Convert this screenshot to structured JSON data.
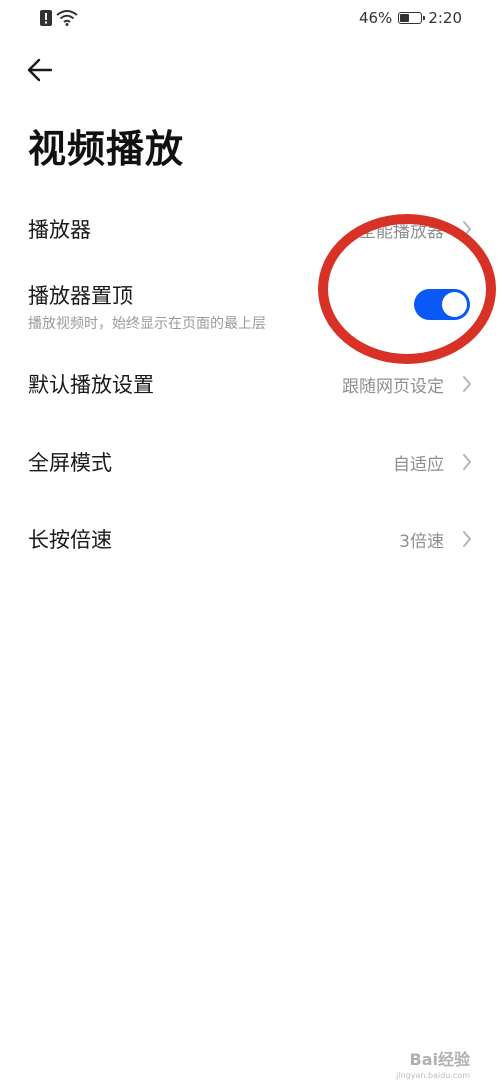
{
  "status_bar": {
    "battery_percent": "46%",
    "battery_level": 0.46,
    "time": "2:20"
  },
  "header": {
    "back_icon": "arrow-left-icon",
    "title": "视频播放"
  },
  "settings": [
    {
      "label": "播放器",
      "value": "全能播放器"
    },
    {
      "label": "播放器置顶",
      "description": "播放视频时，始终显示在页面的最上层",
      "toggle_on": true
    },
    {
      "label": "默认播放设置",
      "value": "跟随网页设定"
    },
    {
      "label": "全屏模式",
      "value": "自适应"
    },
    {
      "label": "长按倍速",
      "value": "3倍速"
    }
  ],
  "watermark": {
    "text": "Bai经验",
    "sub": "jingyan.baidu.com"
  },
  "colors": {
    "accent": "#0a59f7",
    "annotation": "#d83227"
  }
}
